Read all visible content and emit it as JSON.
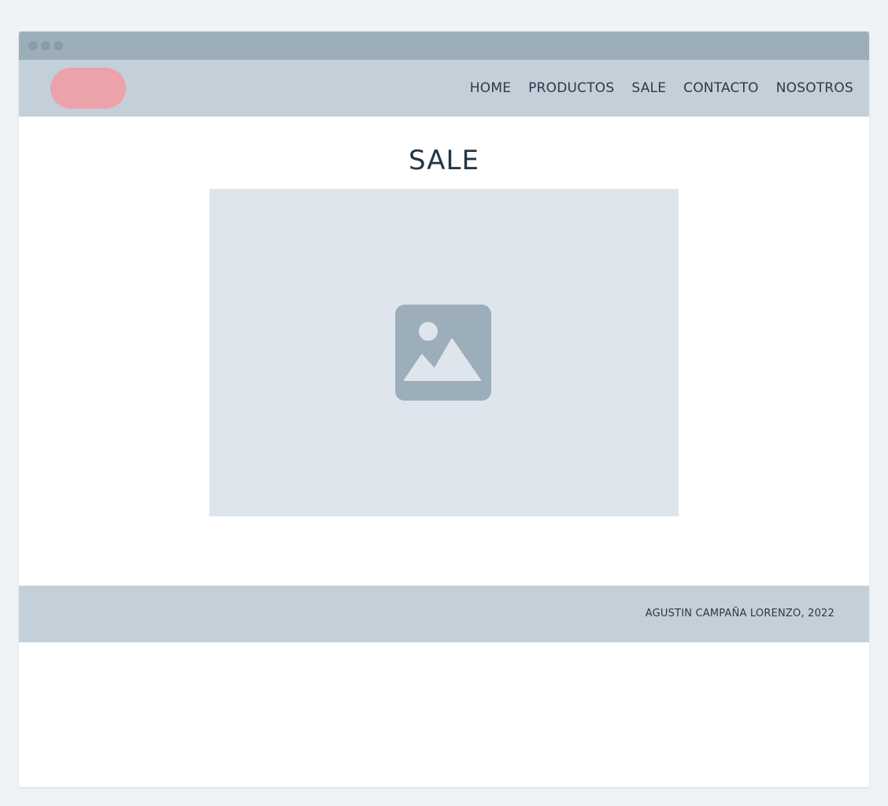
{
  "nav": {
    "items": [
      {
        "label": "HOME"
      },
      {
        "label": "PRODUCTOS"
      },
      {
        "label": "SALE"
      },
      {
        "label": "CONTACTO"
      },
      {
        "label": "NOSOTROS"
      }
    ]
  },
  "main": {
    "title": "SALE",
    "image_icon": "image-placeholder-icon"
  },
  "footer": {
    "text": "AGUSTIN CAMPAÑA LORENZO, 2022"
  },
  "colors": {
    "background": "#eff3f6",
    "titlebar": "#9daebb",
    "navbar": "#c3d0d9",
    "logo": "#eba2ab",
    "image_placeholder": "#dfe5ed",
    "image_icon": "#9daebb",
    "text": "#243545"
  }
}
